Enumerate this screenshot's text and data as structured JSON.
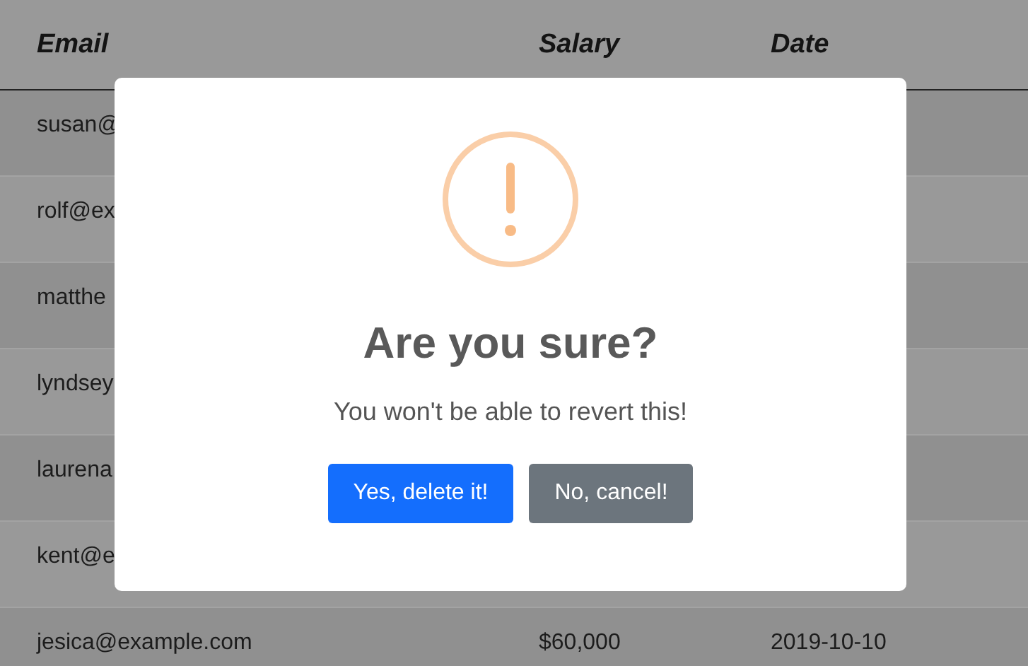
{
  "table": {
    "columns": [
      "Email",
      "Salary",
      "Date"
    ],
    "rows": [
      {
        "email": "susan@"
      },
      {
        "email": "rolf@ex"
      },
      {
        "email": "matthe"
      },
      {
        "email": "lyndsey"
      },
      {
        "email": "laurena"
      },
      {
        "email": "kent@e"
      },
      {
        "email": "jesica@example.com",
        "salary": "$60,000",
        "date": "2019-10-10"
      }
    ]
  },
  "dialog": {
    "title": "Are you sure?",
    "text": "You won't be able to revert this!",
    "buttons": [
      {
        "label": "Yes, delete it!",
        "kind": "confirm"
      },
      {
        "label": "No, cancel!",
        "kind": "cancel"
      }
    ]
  }
}
